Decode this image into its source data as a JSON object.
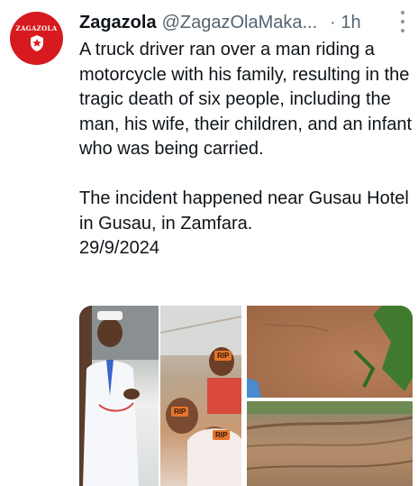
{
  "avatar": {
    "logo_text": "ZAGAZOLA"
  },
  "tweet": {
    "display_name": "Zagazola",
    "handle": "@ZagazOlaMaka...",
    "time": "· 1h",
    "paragraphs": [
      "A truck driver ran over a man riding a motorcycle with his family, resulting in the tragic death of six people, including the man, his wife, their children, and an infant who was being carried.",
      "The incident happened near Gusau Hotel in Gusau, in Zamfara.",
      "29/9/2024"
    ]
  },
  "media": {
    "rip_labels": [
      "RIP",
      "RIP",
      "RIP"
    ]
  },
  "colors": {
    "brand_red": "#d71920",
    "muted": "#536471",
    "text": "#0f1419"
  }
}
